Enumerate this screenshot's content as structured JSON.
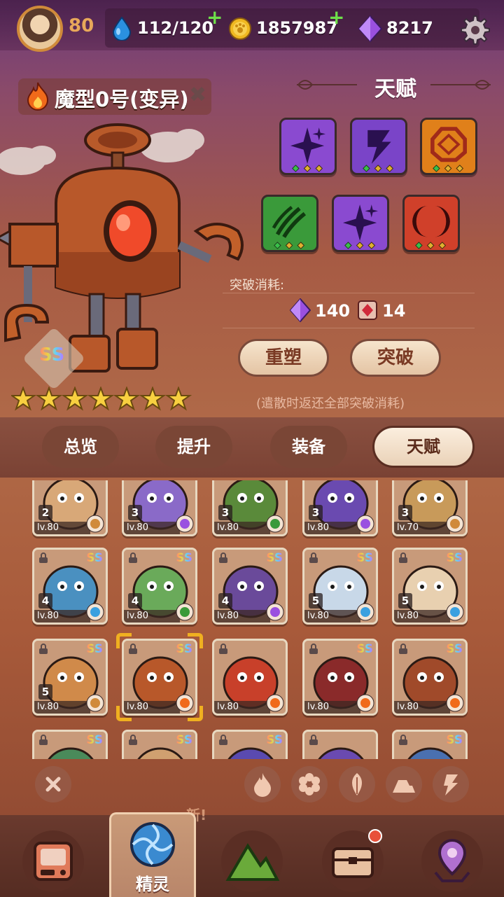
{
  "player": {
    "level": "80",
    "energy": "112/120",
    "gold": "1857987",
    "gems": "8217"
  },
  "character": {
    "name": "魔型0号(变异)",
    "rank": "SS",
    "stars": 7
  },
  "talent_panel": {
    "title": "天赋",
    "breakthrough_label": "突破消耗:",
    "cost_gems": "140",
    "cost_item": "14",
    "reforge_button": "重塑",
    "breakthrough_button": "突破",
    "note": "(遣散时返还全部突破消耗)"
  },
  "skills": [
    {
      "icon": "purple-sparkle-icon",
      "color": "#8a4ad0"
    },
    {
      "icon": "purple-lightning-icon",
      "color": "#7a44c8"
    },
    {
      "icon": "orange-gem-icon",
      "color": "#e0801a"
    },
    {
      "icon": "green-claw-icon",
      "color": "#3a9a3a"
    },
    {
      "icon": "purple-sparkle-icon",
      "color": "#8a4ad0"
    },
    {
      "icon": "red-crescent-icon",
      "color": "#d0402a"
    }
  ],
  "tabs": [
    "总览",
    "提升",
    "装备",
    "天赋"
  ],
  "active_tab": "天赋",
  "monsters": [
    {
      "stars": "2",
      "level": "lv.80",
      "element": "earth",
      "rank": ""
    },
    {
      "stars": "3",
      "level": "lv.80",
      "element": "lightning",
      "rank": ""
    },
    {
      "stars": "3",
      "level": "lv.80",
      "element": "leaf",
      "rank": ""
    },
    {
      "stars": "3",
      "level": "lv.80",
      "element": "lightning",
      "rank": ""
    },
    {
      "stars": "3",
      "level": "lv.70",
      "element": "earth",
      "rank": ""
    },
    {
      "stars": "4",
      "level": "lv.80",
      "element": "ice",
      "rank": "SS"
    },
    {
      "stars": "4",
      "level": "lv.80",
      "element": "leaf",
      "rank": "SS"
    },
    {
      "stars": "4",
      "level": "lv.80",
      "element": "lightning",
      "rank": "SS"
    },
    {
      "stars": "5",
      "level": "lv.80",
      "element": "ice",
      "rank": "SS"
    },
    {
      "stars": "5",
      "level": "lv.80",
      "element": "ice",
      "rank": "SS"
    },
    {
      "stars": "5",
      "level": "lv.80",
      "element": "earth",
      "rank": "SS"
    },
    {
      "stars": "",
      "level": "lv.80",
      "element": "fire",
      "rank": "SS"
    },
    {
      "stars": "",
      "level": "lv.80",
      "element": "fire",
      "rank": ""
    },
    {
      "stars": "",
      "level": "lv.80",
      "element": "fire",
      "rank": "SS"
    },
    {
      "stars": "",
      "level": "lv.80",
      "element": "fire",
      "rank": "SS"
    },
    {
      "stars": "",
      "level": "",
      "element": "",
      "rank": "SS"
    },
    {
      "stars": "",
      "level": "",
      "element": "",
      "rank": "SS"
    },
    {
      "stars": "",
      "level": "",
      "element": "",
      "rank": "SS"
    },
    {
      "stars": "",
      "level": "",
      "element": "",
      "rank": ""
    },
    {
      "stars": "",
      "level": "",
      "element": "",
      "rank": "SS"
    }
  ],
  "filters": [
    "clear-filter-icon",
    "fire-filter-icon",
    "ice-filter-icon",
    "leaf-filter-icon",
    "earth-filter-icon",
    "lightning-filter-icon"
  ],
  "new_tag": "新!",
  "bottom_nav": {
    "active_label": "精灵"
  }
}
